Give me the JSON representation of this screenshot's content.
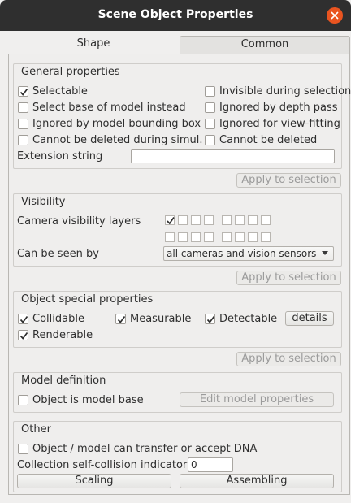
{
  "window": {
    "title": "Scene Object Properties"
  },
  "tabs": [
    {
      "label": "Shape"
    },
    {
      "label": "Common"
    }
  ],
  "general": {
    "title": "General properties",
    "options": [
      {
        "label": "Selectable",
        "checked": true
      },
      {
        "label": "Invisible during selection",
        "checked": false
      },
      {
        "label": "Select base of model instead",
        "checked": false
      },
      {
        "label": "Ignored by depth pass",
        "checked": false
      },
      {
        "label": "Ignored by model bounding  box",
        "checked": false
      },
      {
        "label": "Ignored for view-fitting",
        "checked": false
      },
      {
        "label": "Cannot be deleted during simul.",
        "checked": false
      },
      {
        "label": "Cannot be deleted",
        "checked": false
      }
    ],
    "extension_label": "Extension string",
    "extension_value": "",
    "apply_label": "Apply to selection"
  },
  "visibility": {
    "title": "Visibility",
    "layers_label": "Camera visibility layers",
    "layers_row1": [
      true,
      false,
      false,
      false,
      false,
      false,
      false,
      false
    ],
    "layers_row2": [
      false,
      false,
      false,
      false,
      false,
      false,
      false,
      false
    ],
    "seen_by_label": "Can be seen by",
    "seen_by_value": "all cameras and vision sensors",
    "apply_label": "Apply to selection"
  },
  "special": {
    "title": "Object special properties",
    "collidable": {
      "label": "Collidable",
      "checked": true
    },
    "measurable": {
      "label": "Measurable",
      "checked": true
    },
    "detectable": {
      "label": "Detectable",
      "checked": true
    },
    "renderable": {
      "label": "Renderable",
      "checked": true
    },
    "details_label": "details",
    "apply_label": "Apply to selection"
  },
  "model": {
    "title": "Model definition",
    "is_model_base": {
      "label": "Object is model base",
      "checked": false
    },
    "edit_label": "Edit model properties"
  },
  "other": {
    "title": "Other",
    "dna": {
      "label": "Object / model can transfer or accept DNA",
      "checked": false
    },
    "collision_label": "Collection self-collision indicator",
    "collision_value": "0",
    "scaling_label": "Scaling",
    "assembling_label": "Assembling"
  },
  "colors": {
    "titlebar": "#2f2f2f",
    "close": "#e95420",
    "background": "#f0efee"
  }
}
